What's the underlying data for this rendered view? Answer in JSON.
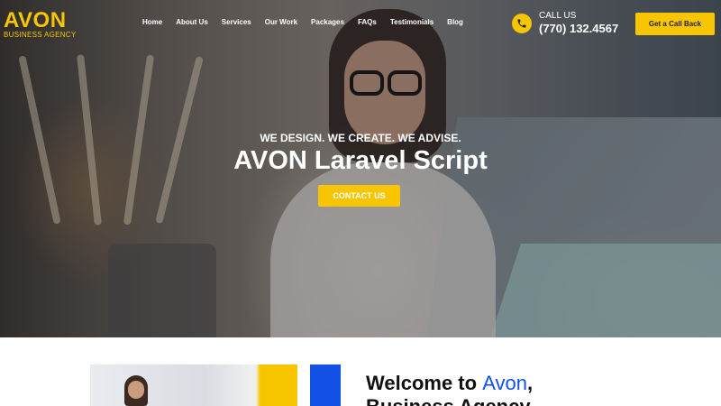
{
  "brand": {
    "name": "AVON",
    "tagline": "BUSINESS AGENCY"
  },
  "nav": {
    "items": [
      "Home",
      "About Us",
      "Services",
      "Our Work",
      "Packages",
      "FAQs",
      "Testimonials",
      "Blog"
    ]
  },
  "call": {
    "label": "CALL US",
    "number": "(770) 132.4567"
  },
  "callback_button": "Get a Call Back",
  "hero": {
    "tagline": "WE DESIGN. WE CREATE. WE ADVISE.",
    "title": "AVON Laravel Script",
    "cta": "CONTACT US"
  },
  "welcome": {
    "prefix": "Welcome to ",
    "accent": "Avon",
    "suffix": ",",
    "line2": "Business Agency"
  },
  "colors": {
    "accent": "#f7c600",
    "blue": "#1250e6"
  },
  "icons": {
    "phone": "phone-icon"
  }
}
